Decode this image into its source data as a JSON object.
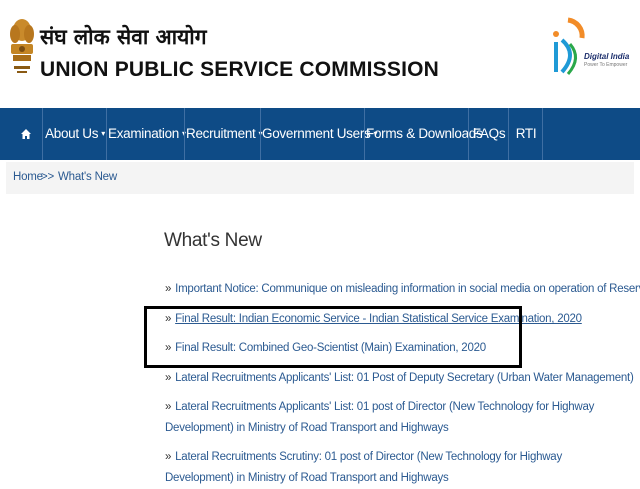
{
  "header": {
    "hindi_title": "संघ लोक सेवा आयोग",
    "org_name": "UNION PUBLIC SERVICE COMMISSION",
    "digital_india": "Digital India",
    "digital_india_tagline": "Power To Empower"
  },
  "nav": {
    "items": [
      {
        "label": "About Us",
        "dropdown": true
      },
      {
        "label": "Examination",
        "dropdown": true
      },
      {
        "label": "Recruitment",
        "dropdown": true
      },
      {
        "label": "Government Users",
        "dropdown": true
      },
      {
        "label": "Forms & Downloads",
        "dropdown": false
      },
      {
        "label": "FAQs",
        "dropdown": false
      },
      {
        "label": "RTI",
        "dropdown": false
      }
    ],
    "caret": "▾",
    "home_icon": "home-icon"
  },
  "breadcrumb": {
    "home": "Home",
    "separator": ">>",
    "current": "What's New"
  },
  "page": {
    "title": "What's New",
    "bullet": "»",
    "items": [
      {
        "text": "Important Notice: Communique on misleading information in social media on operation of Reserve List"
      },
      {
        "text": "Final Result: Indian Economic Service - Indian Statistical Service Examination, 2020"
      },
      {
        "text": "Final Result: Combined Geo-Scientist (Main) Examination, 2020"
      },
      {
        "text": "Lateral Recruitments Applicants' List: 01 Post of Deputy Secretary (Urban Water Management)"
      },
      {
        "text": "Lateral Recruitments Applicants' List: 01 post of Director (New Technology for Highway Development) in Ministry of Road Transport and Highways"
      },
      {
        "text": "Lateral Recruitments Scrutiny: 01 post of Director (New Technology for Highway Development) in Ministry of Road Transport and Highways"
      }
    ]
  },
  "colors": {
    "nav_bg": "#0e4b86",
    "link": "#2b5a91",
    "highlight_border": "#000000"
  }
}
